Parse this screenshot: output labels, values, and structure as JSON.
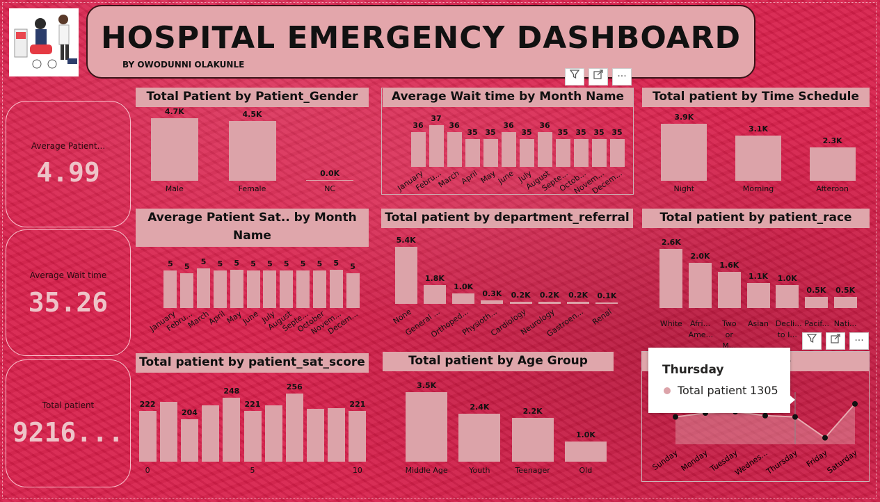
{
  "header": {
    "title": "HOSPITAL EMERGENCY DASHBOARD",
    "subtitle": "BY OWODUNNI OLAKUNLE",
    "logo_icon": "nurse-patient-illustration"
  },
  "kpis": [
    {
      "label": "Average Patient...",
      "value": "4.99"
    },
    {
      "label": "Average Wait time",
      "value": "35.26"
    },
    {
      "label": "Total patient",
      "value": "9216..."
    }
  ],
  "visual_icons": {
    "filter": "filter-icon",
    "focus": "focus-mode-icon",
    "more": "more-options-icon"
  },
  "tooltip": {
    "title": "Thursday",
    "measure": "Total patient",
    "value": "1305"
  },
  "chart_data": [
    {
      "type": "bar",
      "title": "Total Patient by Patient_Gender",
      "categories": [
        "Male",
        "Female",
        "NC"
      ],
      "values": [
        4700,
        4500,
        0
      ],
      "value_labels": [
        "4.7K",
        "4.5K",
        "0.0K"
      ]
    },
    {
      "type": "bar",
      "title": "Average Wait time by Month Name",
      "categories": [
        "January",
        "Febru...",
        "March",
        "April",
        "May",
        "June",
        "July",
        "August",
        "Septe...",
        "Octob...",
        "Novem...",
        "Decem..."
      ],
      "values": [
        36,
        37,
        36,
        35,
        35,
        36,
        35,
        36,
        35,
        35,
        35,
        35
      ],
      "value_labels": [
        "36",
        "37",
        "36",
        "35",
        "35",
        "36",
        "35",
        "36",
        "35",
        "35",
        "35",
        "35"
      ]
    },
    {
      "type": "bar",
      "title": "Total patient by Time Schedule",
      "categories": [
        "Night",
        "Morning",
        "Afteroon"
      ],
      "values": [
        3900,
        3100,
        2300
      ],
      "value_labels": [
        "3.9K",
        "3.1K",
        "2.3K"
      ]
    },
    {
      "type": "bar",
      "title": "Average Patient Sat.. by Month Name",
      "categories": [
        "January",
        "Febru...",
        "March",
        "April",
        "May",
        "June",
        "July",
        "August",
        "Septe...",
        "October",
        "Novem...",
        "Decem..."
      ],
      "values": [
        5,
        5,
        5,
        5,
        5,
        5,
        5,
        5,
        5,
        5,
        5,
        5
      ],
      "value_labels": [
        "5",
        "5",
        "5",
        "5",
        "5",
        "5",
        "5",
        "5",
        "5",
        "5",
        "5",
        "5"
      ]
    },
    {
      "type": "bar",
      "title": "Total patient by department_referral",
      "categories": [
        "None",
        "General ...",
        "Orthoped...",
        "Physioth...",
        "Cardiology",
        "Neurology",
        "Gastroen...",
        "Renal"
      ],
      "values": [
        5400,
        1800,
        1000,
        300,
        200,
        200,
        200,
        100
      ],
      "value_labels": [
        "5.4K",
        "1.8K",
        "1.0K",
        "0.3K",
        "0.2K",
        "0.2K",
        "0.2K",
        "0.1K"
      ]
    },
    {
      "type": "bar",
      "title": "Total patient by patient_race",
      "categories": [
        "White",
        "Afri... Ame...",
        "Two or M...",
        "Asian",
        "Decli... to I...",
        "Pacif...",
        "Nati..."
      ],
      "values": [
        2600,
        2000,
        1600,
        1100,
        1000,
        500,
        500
      ],
      "value_labels": [
        "2.6K",
        "2.0K",
        "1.6K",
        "1.1K",
        "1.0K",
        "0.5K",
        "0.5K"
      ]
    },
    {
      "type": "bar",
      "title": "Total patient by patient_sat_score",
      "x_ticks": [
        "0",
        "5",
        "10"
      ],
      "categories": [
        "0",
        "1",
        "2",
        "3",
        "4",
        "5",
        "6",
        "7",
        "8",
        "9",
        "10"
      ],
      "values": [
        222,
        240,
        204,
        232,
        248,
        221,
        232,
        256,
        225,
        227,
        221
      ],
      "value_labels": [
        "222",
        "",
        "204",
        "",
        "248",
        "221",
        "",
        "256",
        "",
        "",
        "221"
      ]
    },
    {
      "type": "bar",
      "title": "Total patient by Age Group",
      "categories": [
        "Middle Age",
        "Youth",
        "Teenager",
        "Old"
      ],
      "values": [
        3500,
        2400,
        2200,
        1000
      ],
      "value_labels": [
        "3.5K",
        "2.4K",
        "2.2K",
        "1.0K"
      ]
    },
    {
      "type": "area",
      "title": "...ay Name",
      "categories": [
        "Sunday",
        "Monday",
        "Tuesday",
        "Wednes...",
        "Thursday",
        "Friday",
        "Saturday"
      ],
      "values": [
        1305,
        1320,
        1325,
        1310,
        1305,
        1225,
        1355
      ]
    }
  ]
}
